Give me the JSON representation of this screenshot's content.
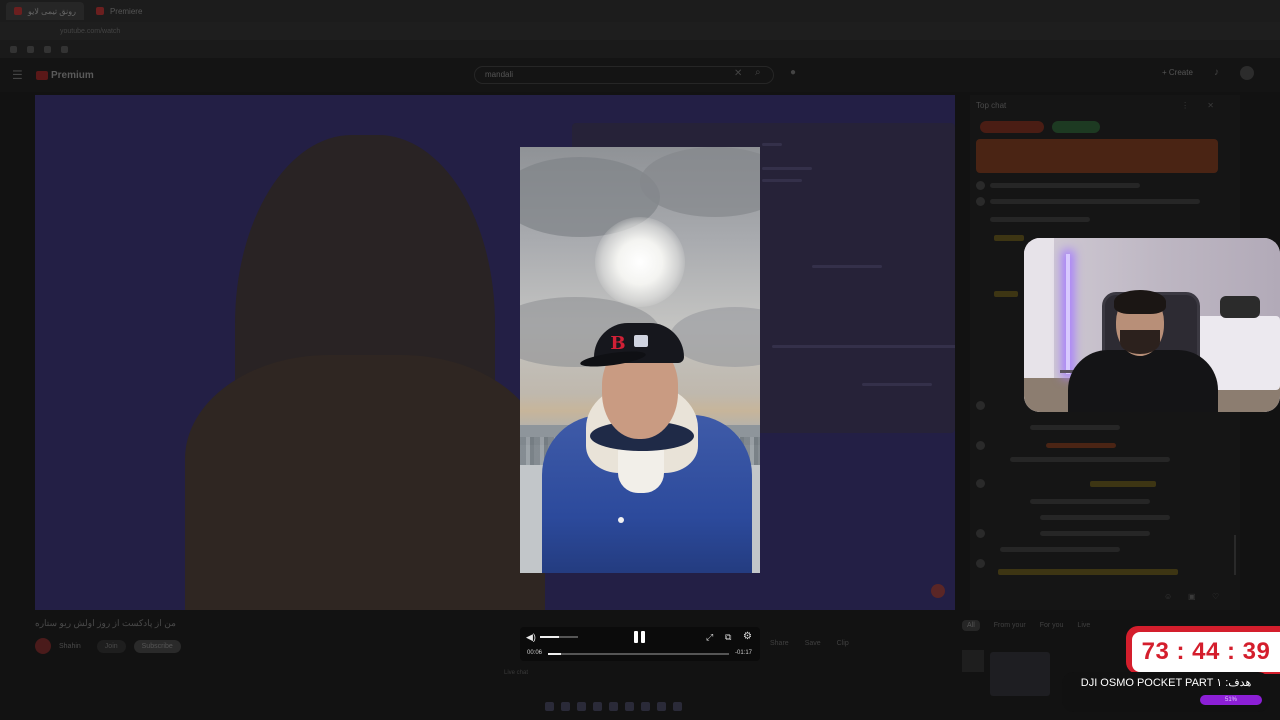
{
  "browser": {
    "tabs": [
      {
        "label": "رونق تیمی لایو"
      },
      {
        "label": "Premiere"
      },
      {
        "label": ""
      }
    ],
    "url": "youtube.com/watch"
  },
  "youtube": {
    "logo_text": "Premium",
    "search_value": "mandali",
    "create_label": "Create",
    "video_title": "من از پادکست از روز اولش ریو ستاره",
    "channel_name": "Shahin",
    "join_label": "Join",
    "subscribe_label": "Subscribe",
    "live_chat_note": "Live chat",
    "actions": [
      "Share",
      "Save",
      "Clip"
    ]
  },
  "chat": {
    "header": "Top chat"
  },
  "suggestions": {
    "chips": [
      "All",
      "From your",
      "For you",
      "Live"
    ]
  },
  "player": {
    "current_time": "00:06",
    "remaining_time": "-01:17",
    "progress": 0.07,
    "volume": 0.5,
    "logo_letter": "B"
  },
  "overlay": {
    "timer": "73 : 44 : 39",
    "goal_text": "DJI OSMO POCKET PART ۱ :هدف",
    "goal_status": "51%",
    "accent_color": "#d41e2c",
    "goal_bar_color": "#8c1fd6"
  }
}
